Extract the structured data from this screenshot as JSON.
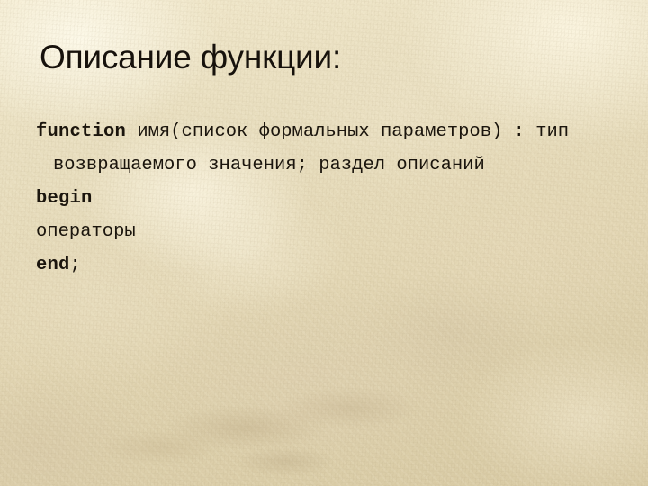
{
  "slide": {
    "title": "Описание функции:",
    "background_color": "#e8ddbd",
    "text_color": "#1b150d",
    "title_color": "#17120c"
  },
  "code": {
    "lines": [
      {
        "id": "signature",
        "segments": [
          {
            "text": "function",
            "style": "keyword"
          },
          {
            "text": " имя(список формальных параметров) : тип возвращаемого значения; раздел описаний",
            "style": "plain"
          }
        ],
        "full_text": "function имя(список формальных параметров) : тип возвращаемого значения; раздел описаний"
      },
      {
        "id": "begin",
        "segments": [
          {
            "text": "begin",
            "style": "keyword"
          }
        ],
        "full_text": "begin"
      },
      {
        "id": "statements",
        "segments": [
          {
            "text": "операторы",
            "style": "plain"
          }
        ],
        "full_text": "операторы"
      },
      {
        "id": "end",
        "segments": [
          {
            "text": "end",
            "style": "keyword"
          },
          {
            "text": ";",
            "style": "punct"
          }
        ],
        "full_text": "end;"
      }
    ],
    "line_1_keyword": "function",
    "line_1_rest": " имя(список формальных параметров) : тип возвращаемого значения; раздел описаний",
    "line_2_keyword": "begin",
    "line_3_text": "операторы",
    "line_4_keyword": "end",
    "line_4_punct": ";"
  }
}
